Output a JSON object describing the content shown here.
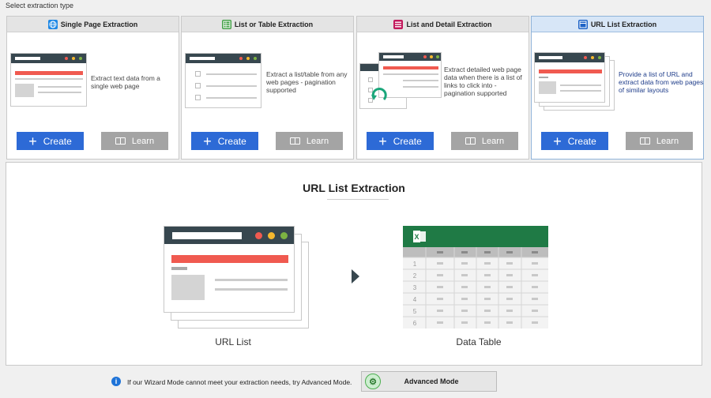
{
  "header": {
    "label": "Select extraction type"
  },
  "cards": [
    {
      "title": "Single Page Extraction",
      "icon": "globe-icon",
      "icon_color": "#1e88e5",
      "description": "Extract text data from a single web page",
      "create": "Create",
      "learn": "Learn"
    },
    {
      "title": "List or Table Extraction",
      "icon": "table-icon",
      "icon_color": "#43a047",
      "description": "Extract a list/table from any web pages - pagination supported",
      "create": "Create",
      "learn": "Learn"
    },
    {
      "title": "List and Detail Extraction",
      "icon": "list-detail-icon",
      "icon_color": "#c2185b",
      "description": "Extract detailed web page data when there is a list of links to click into - pagination supported",
      "create": "Create",
      "learn": "Learn"
    },
    {
      "title": "URL List Extraction",
      "icon": "url-list-icon",
      "icon_color": "#1e63c7",
      "description": "Provide a list of URL and extract data from web pages of similar layouts",
      "create": "Create",
      "learn": "Learn",
      "selected": true
    }
  ],
  "detail": {
    "title": "URL List Extraction",
    "left_caption": "URL List",
    "right_caption": "Data Table",
    "row_numbers": [
      "1",
      "2",
      "3",
      "4",
      "5",
      "6"
    ]
  },
  "footer": {
    "info_text": "If our Wizard Mode cannot meet your extraction needs, try Advanced Mode.",
    "advanced_button": "Advanced Mode"
  },
  "colors": {
    "accent": "#2d6ad6",
    "learn_gray": "#a4a4a4",
    "browser_bar": "#37474f",
    "excel_green": "#1f7a45",
    "content_red": "#f05a50"
  }
}
